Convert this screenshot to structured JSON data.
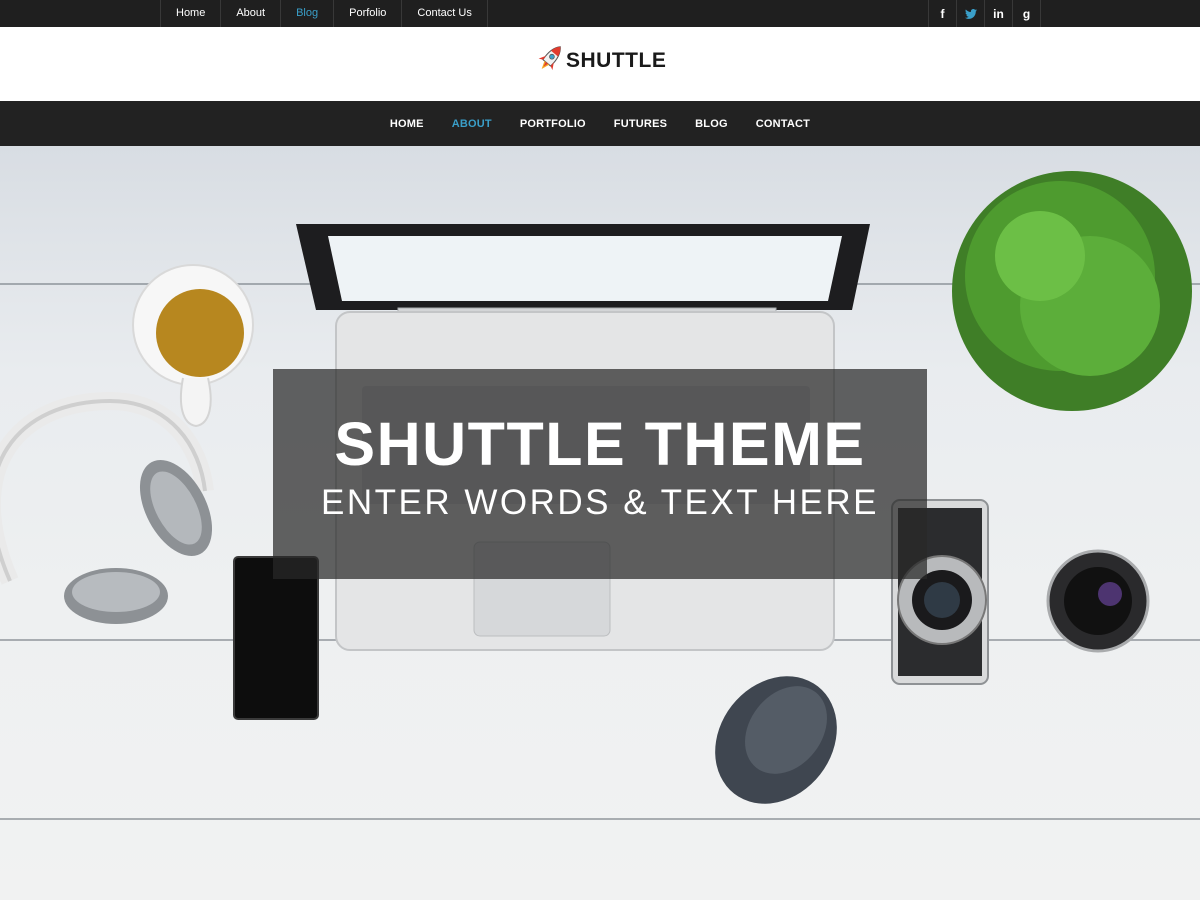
{
  "topbar": {
    "links": [
      {
        "label": "Home"
      },
      {
        "label": "About"
      },
      {
        "label": "Blog"
      },
      {
        "label": "Porfolio"
      },
      {
        "label": "Contact Us"
      }
    ],
    "active_link": "Blog",
    "social": [
      {
        "icon": "facebook-icon",
        "glyph": "f"
      },
      {
        "icon": "twitter-icon",
        "glyph": "t"
      },
      {
        "icon": "linkedin-icon",
        "glyph": "in"
      },
      {
        "icon": "google-icon",
        "glyph": "g"
      }
    ]
  },
  "header": {
    "logo_text": "SHUTTLE",
    "logo_icon": "rocket-icon"
  },
  "nav": {
    "items": [
      {
        "label": "HOME"
      },
      {
        "label": "ABOUT"
      },
      {
        "label": "PORTFOLIO"
      },
      {
        "label": "FUTURES"
      },
      {
        "label": "BLOG"
      },
      {
        "label": "CONTACT"
      }
    ],
    "active_item": "ABOUT"
  },
  "hero": {
    "title": "SHUTTLE THEME",
    "subtitle": "ENTER WORDS & TEXT HERE"
  },
  "colors": {
    "accent": "#3a9fc9",
    "topbar_bg": "#1f1f1f",
    "nav_bg": "#222222",
    "rocket_red": "#e23b2e"
  }
}
